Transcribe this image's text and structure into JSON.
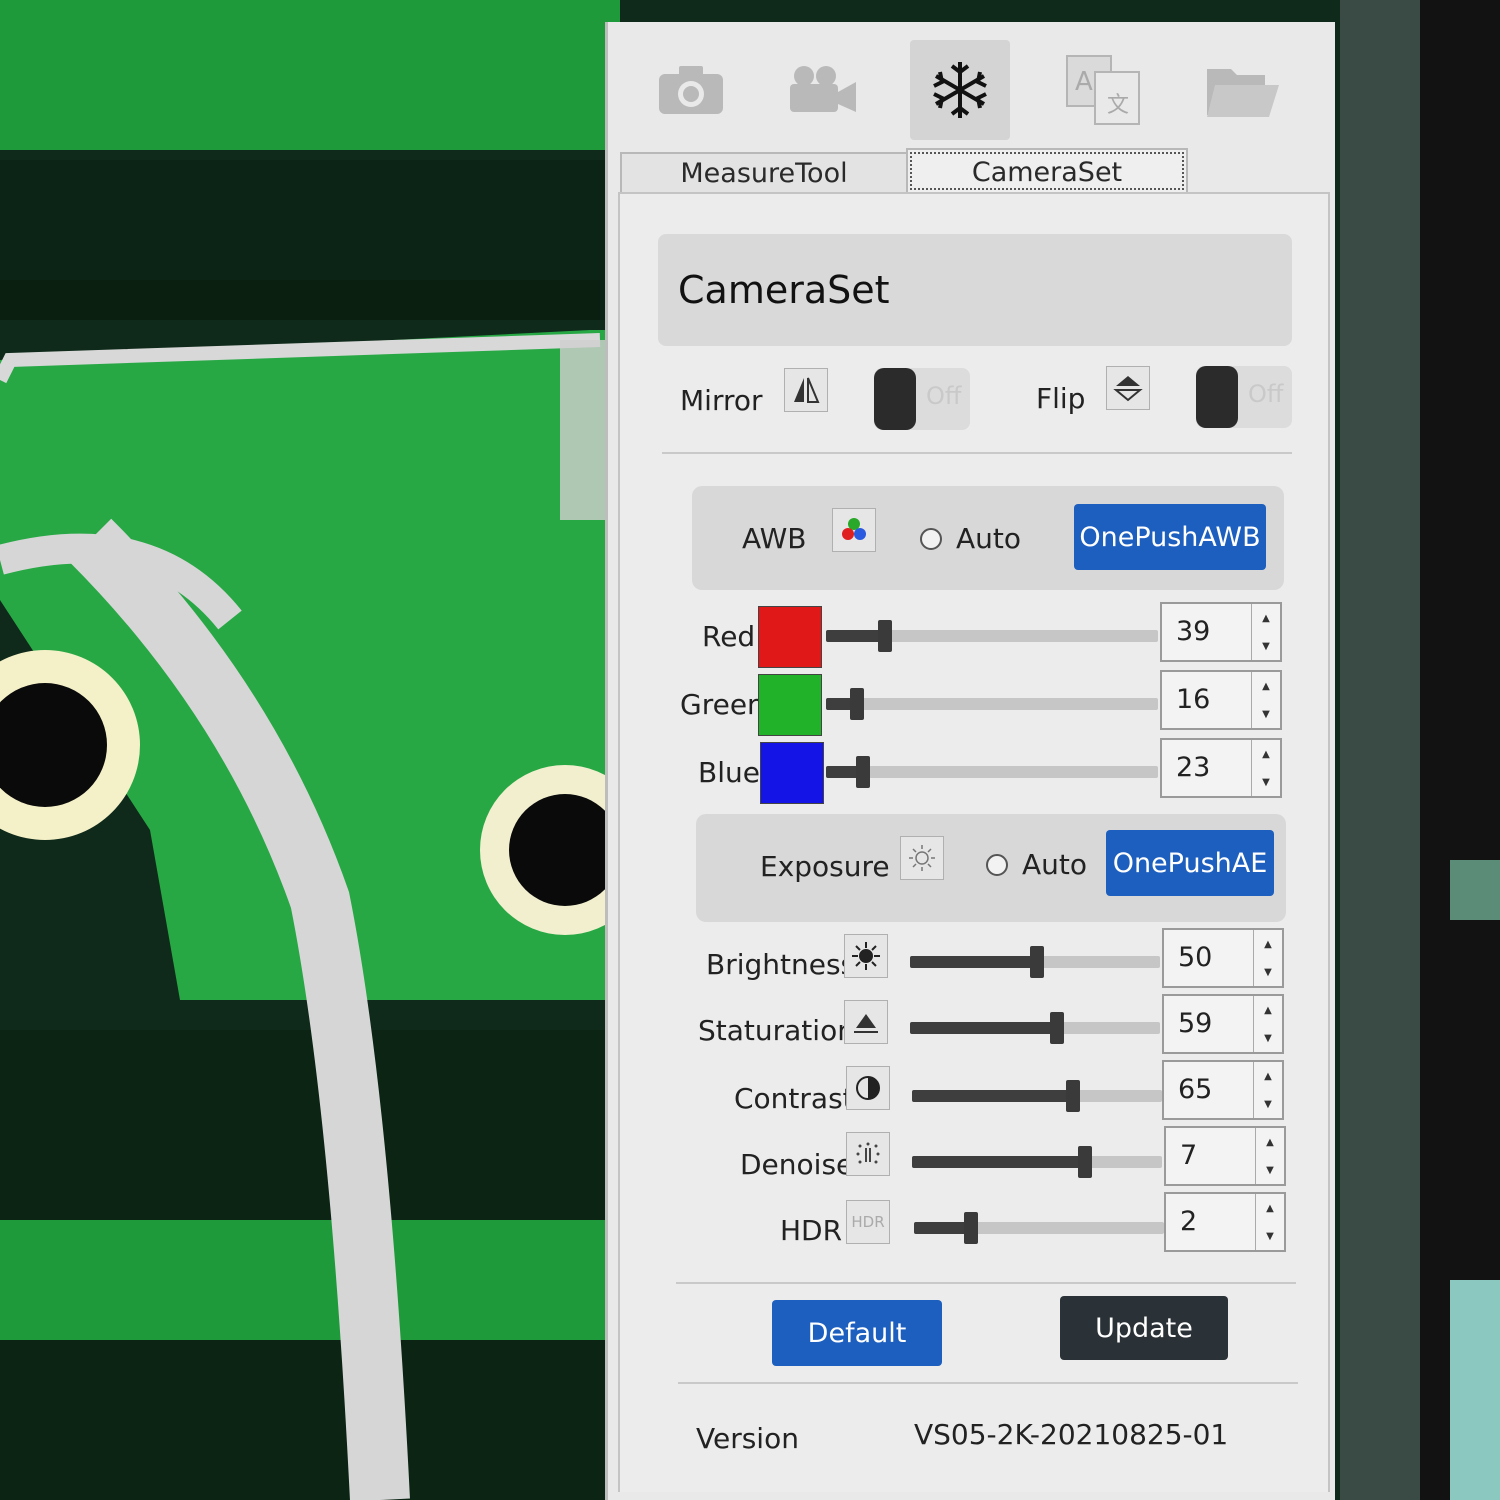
{
  "toolbar": {
    "icons": [
      "camera-icon",
      "video-camera-icon",
      "snowflake-icon",
      "translate-icon",
      "folder-icon"
    ]
  },
  "tabs": {
    "measure_tool": "MeasureTool",
    "camera_set": "CameraSet"
  },
  "section_title": "CameraSet",
  "mirror": {
    "label": "Mirror",
    "state": "Off"
  },
  "flip": {
    "label": "Flip",
    "state": "Off"
  },
  "awb": {
    "label": "AWB",
    "auto_label": "Auto",
    "button": "OnePushAWB"
  },
  "colors": {
    "red": {
      "label": "Red",
      "value": "39",
      "swatch": "#e01818"
    },
    "green": {
      "label": "Green",
      "value": "16",
      "swatch": "#22b22a"
    },
    "blue": {
      "label": "Blue",
      "value": "23",
      "swatch": "#1414e6"
    }
  },
  "exposure": {
    "label": "Exposure",
    "auto_label": "Auto",
    "button": "OnePushAE"
  },
  "adjust": {
    "brightness": {
      "label": "Brightness",
      "value": "50",
      "level": 0.51
    },
    "saturation": {
      "label": "Staturation",
      "value": "59",
      "level": 0.59
    },
    "contrast": {
      "label": "Contrast",
      "value": "65",
      "level": 0.65
    },
    "denoise": {
      "label": "Denoise",
      "value": "7",
      "level": 0.7
    },
    "hdr": {
      "label": "HDR",
      "value": "2",
      "level": 0.22,
      "icon_text": "HDR"
    }
  },
  "buttons": {
    "default": "Default",
    "update": "Update"
  },
  "version": {
    "label": "Version",
    "value": "VS05-2K-20210825-01"
  },
  "accent": "#1d5fbf"
}
